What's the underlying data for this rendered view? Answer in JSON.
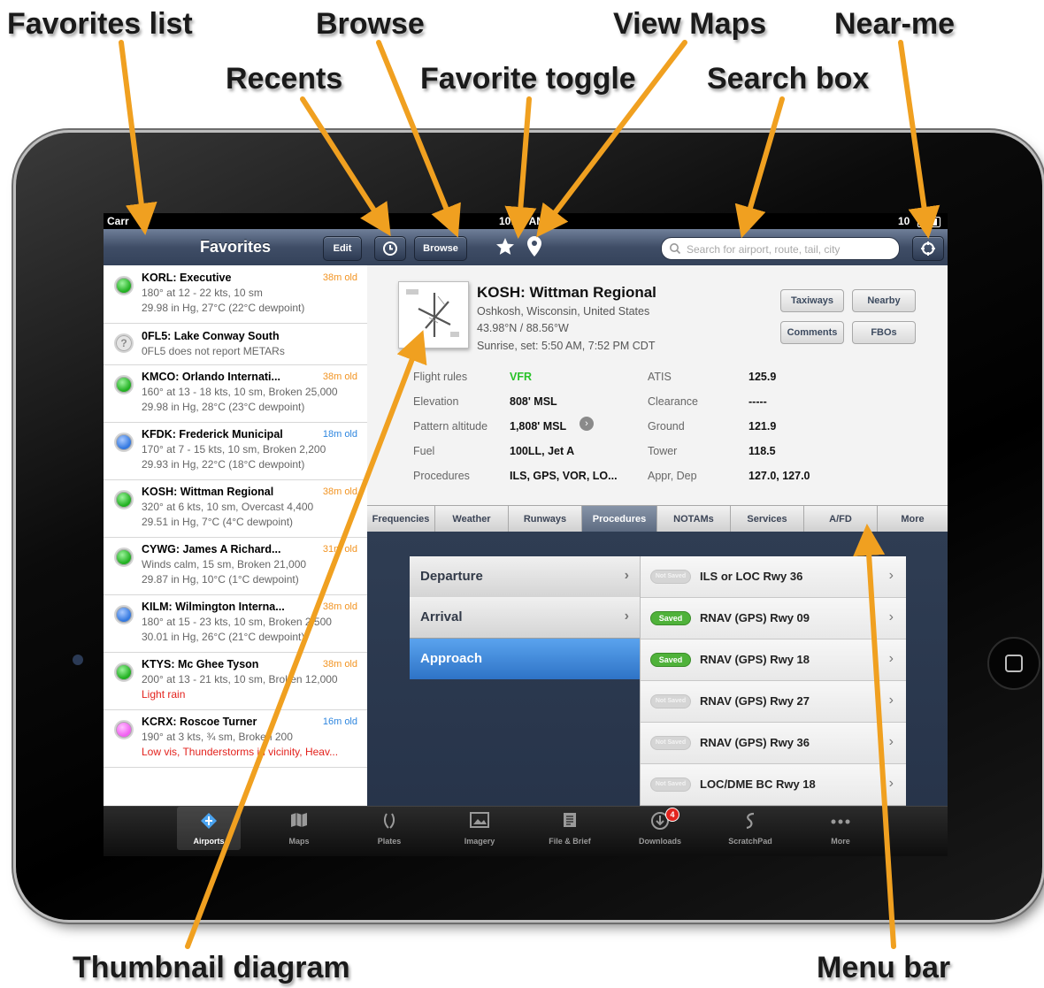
{
  "callouts": {
    "favorites_list": "Favorites list",
    "browse": "Browse",
    "view_maps": "View Maps",
    "near_me": "Near-me",
    "recents": "Recents",
    "favorite_toggle": "Favorite toggle",
    "search_box": "Search box",
    "thumbnail_diagram": "Thumbnail diagram",
    "menu_bar": "Menu bar"
  },
  "status_bar": {
    "carrier": "Carr",
    "time": "10:47 AM",
    "battery": "10"
  },
  "header": {
    "favorites_title": "Favorites",
    "edit_label": "Edit",
    "browse_label": "Browse",
    "search_placeholder": "Search for airport, route, tail, city"
  },
  "favorites": [
    {
      "name": "KORL: Executive",
      "age": "38m old",
      "status": "green",
      "line1": "180° at 12 - 22 kts, 10 sm",
      "line2": "29.98 in Hg, 27°C (22°C dewpoint)"
    },
    {
      "name": "0FL5: Lake Conway South",
      "age": "",
      "status": "none",
      "line1": "0FL5 does not report METARs",
      "line2": ""
    },
    {
      "name": "KMCO: Orlando Internati...",
      "age": "38m old",
      "status": "green",
      "line1": "160° at 13 - 18 kts, 10 sm, Broken 25,000",
      "line2": "29.98 in Hg, 28°C (23°C dewpoint)"
    },
    {
      "name": "KFDK: Frederick Municipal",
      "age": "18m old",
      "status": "blue",
      "line1": "170° at 7 - 15 kts, 10 sm, Broken 2,200",
      "line2": "29.93 in Hg, 22°C (18°C dewpoint)"
    },
    {
      "name": "KOSH: Wittman Regional",
      "age": "38m old",
      "status": "green",
      "line1": "320° at 6 kts, 10 sm, Overcast 4,400",
      "line2": "29.51 in Hg, 7°C (4°C dewpoint)"
    },
    {
      "name": "CYWG: James A Richard...",
      "age": "31m old",
      "status": "green",
      "line1": "Winds calm, 15 sm, Broken 21,000",
      "line2": "29.87 in Hg, 10°C (1°C dewpoint)"
    },
    {
      "name": "KILM: Wilmington Interna...",
      "age": "38m old",
      "status": "blue",
      "line1": "180° at 15 - 23 kts, 10 sm, Broken 2,500",
      "line2": "30.01 in Hg, 26°C (21°C dewpoint)"
    },
    {
      "name": "KTYS: Mc Ghee Tyson",
      "age": "38m old",
      "status": "green",
      "line1": "200° at 13 - 21 kts, 10 sm, Broken 12,000",
      "line2": "Light rain",
      "line2_red": true
    },
    {
      "name": "KCRX: Roscoe Turner",
      "age": "16m old",
      "status": "magenta",
      "line1": "190° at 3 kts, ¾ sm, Broken 200",
      "line2": "Low vis, Thunderstorms in vicinity, Heav...",
      "line2_red": true
    }
  ],
  "airport": {
    "name": "KOSH: Wittman Regional",
    "location": "Oshkosh, Wisconsin, United States",
    "coords": "43.98°N / 88.56°W",
    "sun": "Sunrise, set: 5:50 AM, 7:52 PM CDT",
    "buttons": [
      "Taxiways",
      "Nearby",
      "Comments",
      "FBOs"
    ],
    "rows_left": [
      {
        "label": "Flight rules",
        "value": "VFR"
      },
      {
        "label": "Elevation",
        "value": "808' MSL"
      },
      {
        "label": "Pattern altitude",
        "value": "1,808' MSL"
      },
      {
        "label": "Fuel",
        "value": "100LL, Jet A"
      },
      {
        "label": "Procedures",
        "value": "ILS, GPS, VOR, LO..."
      }
    ],
    "rows_right": [
      {
        "label": "ATIS",
        "value": "125.9"
      },
      {
        "label": "Clearance",
        "value": "-----"
      },
      {
        "label": "Ground",
        "value": "121.9"
      },
      {
        "label": "Tower",
        "value": "118.5"
      },
      {
        "label": "Appr, Dep",
        "value": "127.0, 127.0"
      }
    ]
  },
  "menu_tabs": [
    "Frequencies",
    "Weather",
    "Runways",
    "Procedures",
    "NOTAMs",
    "Services",
    "A/FD",
    "More"
  ],
  "active_menu_tab": "Procedures",
  "procedure_categories": [
    "Departure",
    "Arrival",
    "Approach"
  ],
  "active_category": "Approach",
  "procedures": [
    {
      "saved": false,
      "badge": "Not Saved",
      "name": "ILS or LOC Rwy 36"
    },
    {
      "saved": true,
      "badge": "Saved",
      "name": "RNAV (GPS) Rwy 09"
    },
    {
      "saved": true,
      "badge": "Saved",
      "name": "RNAV (GPS) Rwy 18"
    },
    {
      "saved": false,
      "badge": "Not Saved",
      "name": "RNAV (GPS) Rwy 27"
    },
    {
      "saved": false,
      "badge": "Not Saved",
      "name": "RNAV (GPS) Rwy 36"
    },
    {
      "saved": false,
      "badge": "Not Saved",
      "name": "LOC/DME BC Rwy 18"
    }
  ],
  "tab_bar": [
    {
      "label": "Airports",
      "icon": "airport-icon"
    },
    {
      "label": "Maps",
      "icon": "maps-icon"
    },
    {
      "label": "Plates",
      "icon": "plates-icon"
    },
    {
      "label": "Imagery",
      "icon": "imagery-icon"
    },
    {
      "label": "File & Brief",
      "icon": "file-brief-icon"
    },
    {
      "label": "Downloads",
      "icon": "downloads-icon",
      "badge": "4"
    },
    {
      "label": "ScratchPad",
      "icon": "scratchpad-icon"
    },
    {
      "label": "More",
      "icon": "more-icon"
    }
  ],
  "colors": {
    "accent_orange": "#f29422",
    "vfr_green": "#28c228",
    "saved_green": "#4fb23a",
    "active_blue": "#2e73c6"
  }
}
